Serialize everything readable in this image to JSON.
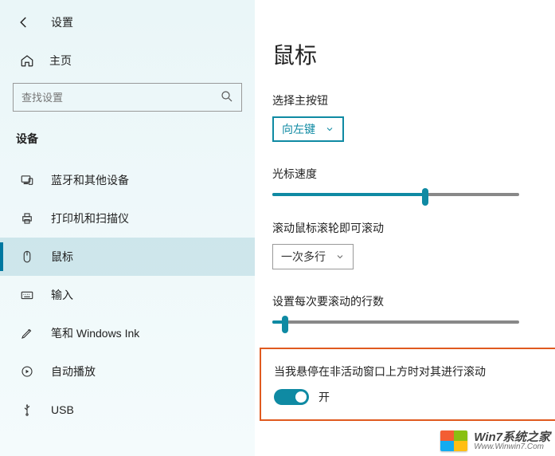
{
  "app_title": "设置",
  "home_label": "主页",
  "search_placeholder": "查找设置",
  "section_title": "设备",
  "nav": [
    {
      "label": "蓝牙和其他设备"
    },
    {
      "label": "打印机和扫描仪"
    },
    {
      "label": "鼠标"
    },
    {
      "label": "输入"
    },
    {
      "label": "笔和 Windows Ink"
    },
    {
      "label": "自动播放"
    },
    {
      "label": "USB"
    }
  ],
  "page_title": "鼠标",
  "primary_button": {
    "label": "选择主按钮",
    "value": "向左键"
  },
  "cursor_speed": {
    "label": "光标速度",
    "percent": 62
  },
  "wheel_scroll": {
    "label": "滚动鼠标滚轮即可滚动",
    "value": "一次多行"
  },
  "lines_scroll": {
    "label": "设置每次要滚动的行数",
    "percent": 5
  },
  "inactive": {
    "label": "当我悬停在非活动窗口上方时对其进行滚动",
    "state": "开"
  },
  "watermark": {
    "line1": "Win7系统之家",
    "line2": "Www.Winwin7.Com"
  }
}
